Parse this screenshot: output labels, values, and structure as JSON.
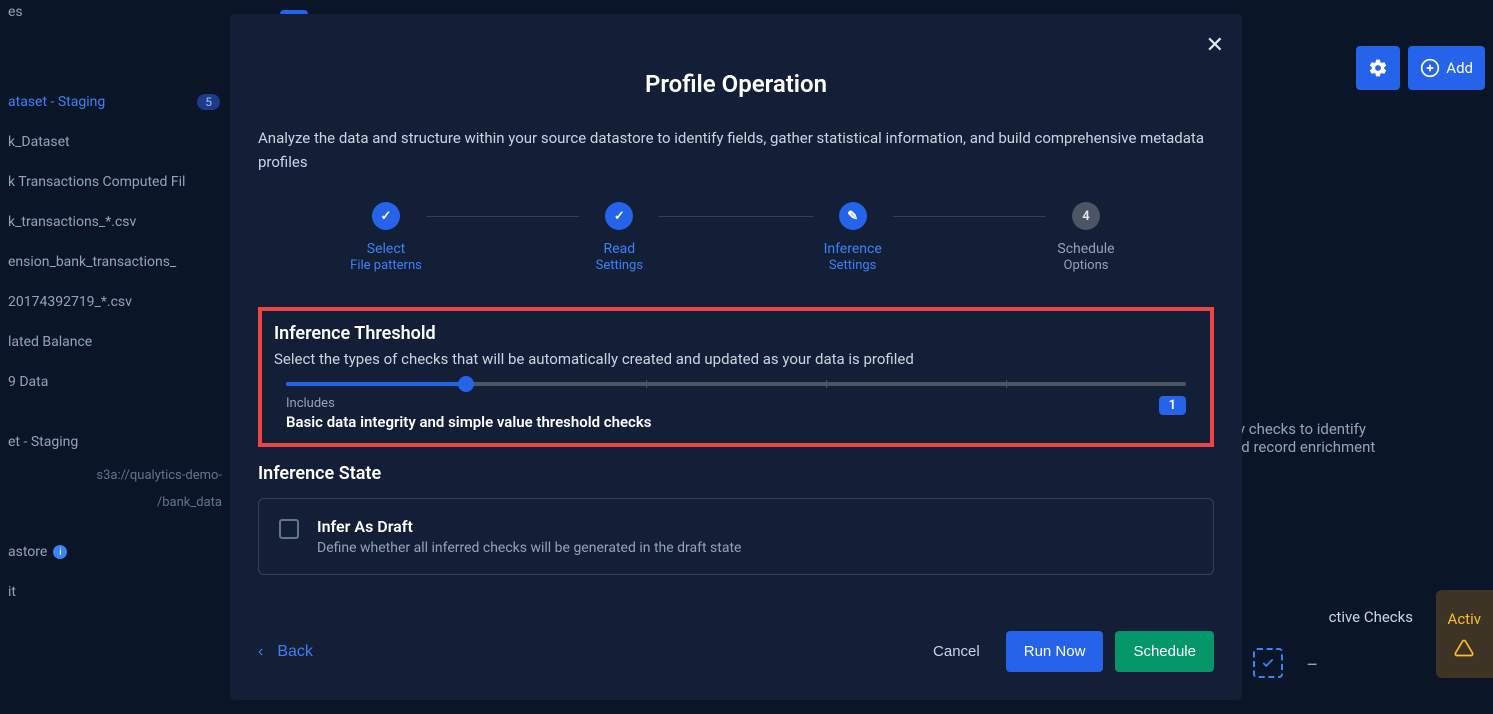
{
  "sidebar": {
    "top_item": {
      "label": "es"
    },
    "items": [
      {
        "label": "ataset - Staging",
        "badge": "5",
        "active": true
      },
      {
        "label": "k_Dataset"
      },
      {
        "label": "k Transactions Computed Fil"
      },
      {
        "label": "k_transactions_*.csv"
      },
      {
        "label": "ension_bank_transactions_"
      },
      {
        "label": "20174392719_*.csv"
      },
      {
        "label": "lated Balance"
      },
      {
        "label": "9 Data"
      },
      {
        "label": "et - Staging"
      }
    ],
    "path_line1": "s3a://qualytics-demo-",
    "path_line2": "/bank_data",
    "datastore_label": "astore",
    "last_label": "it"
  },
  "bg_nav": {
    "refresh": "↻",
    "collapse": "‹"
  },
  "top_buttons": {
    "gear": "⚙",
    "plus": "⊕",
    "add_label": "Add"
  },
  "bg_text": {
    "line1": "ty checks to identify",
    "line2": "nd record enrichment"
  },
  "active_checks_label": "ctive Checks",
  "activ_badge": "Activ",
  "bg_dash": "–",
  "modal": {
    "title": "Profile Operation",
    "description": "Analyze the data and structure within your source datastore to identify fields, gather statistical information, and build comprehensive metadata profiles",
    "steps": [
      {
        "label": "Select",
        "sub": "File patterns",
        "state": "done",
        "icon": "✓"
      },
      {
        "label": "Read",
        "sub": "Settings",
        "state": "done",
        "icon": "✓"
      },
      {
        "label": "Inference",
        "sub": "Settings",
        "state": "current",
        "icon": "✎"
      },
      {
        "label": "Schedule",
        "sub": "Options",
        "state": "pending",
        "icon": "4"
      }
    ],
    "threshold": {
      "title": "Inference Threshold",
      "desc": "Select the types of checks that will be automatically created and updated as your data is profiled",
      "includes_label": "Includes",
      "includes_text": "Basic data integrity and simple value threshold checks",
      "level": "1"
    },
    "state": {
      "title": "Inference State",
      "draft_title": "Infer As Draft",
      "draft_desc": "Define whether all inferred checks will be generated in the draft state"
    },
    "footer": {
      "back": "Back",
      "cancel": "Cancel",
      "run": "Run Now",
      "schedule": "Schedule"
    }
  }
}
